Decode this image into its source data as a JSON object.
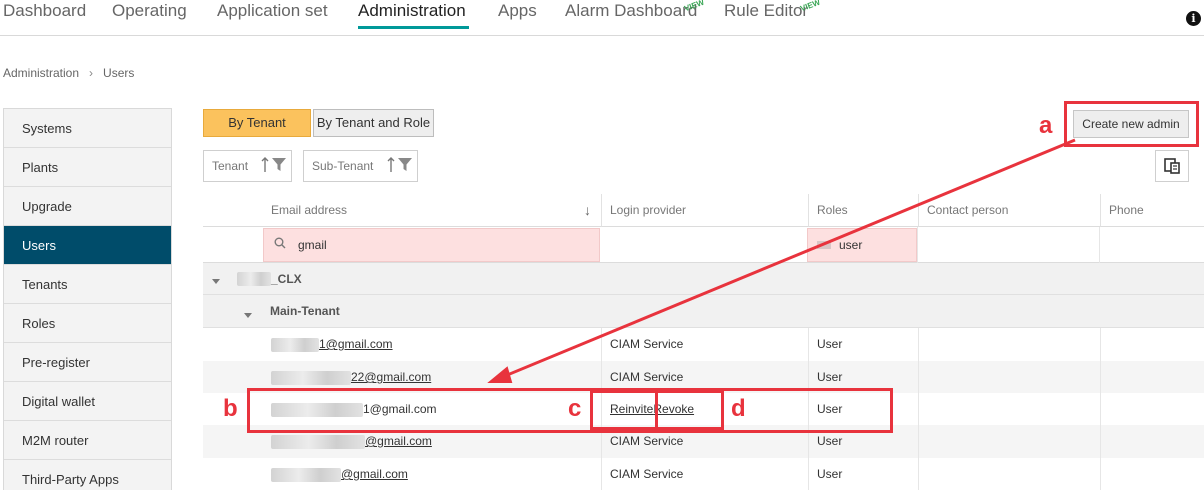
{
  "nav": {
    "tabs": [
      {
        "label": "Dashboard",
        "active": false
      },
      {
        "label": "Operating",
        "active": false
      },
      {
        "label": "Application set",
        "active": false
      },
      {
        "label": "Administration",
        "active": true
      },
      {
        "label": "Apps",
        "active": false
      },
      {
        "label": "Alarm Dashboard",
        "active": false
      },
      {
        "label": "Rule Editor",
        "active": false
      }
    ],
    "preview_badge_1": "VIEW",
    "preview_badge_2": "VIEW",
    "info_icon": "i"
  },
  "breadcrumb": {
    "root": "Administration",
    "current": "Users",
    "separator": "›"
  },
  "sidebar": {
    "items": [
      {
        "label": "Systems"
      },
      {
        "label": "Plants"
      },
      {
        "label": "Upgrade"
      },
      {
        "label": "Users",
        "active": true
      },
      {
        "label": "Tenants"
      },
      {
        "label": "Roles"
      },
      {
        "label": "Pre-register"
      },
      {
        "label": "Digital wallet"
      },
      {
        "label": "M2M router"
      },
      {
        "label": "Third-Party Apps"
      }
    ]
  },
  "toolbar": {
    "by_tenant": "By Tenant",
    "by_tenant_role": "By Tenant and Role",
    "create_admin": "Create new admin",
    "filter_tenant": "Tenant",
    "filter_subtenant": "Sub-Tenant"
  },
  "table": {
    "headers": {
      "email": "Email address",
      "login": "Login provider",
      "roles": "Roles",
      "contact": "Contact person",
      "phone": "Phone"
    },
    "filter_row": {
      "email_value": "gmail",
      "roles_value": "user"
    },
    "group_tenant": "_CLX",
    "group_subtenant": "Main-Tenant",
    "rows": [
      {
        "email": "1@gmail.com",
        "login": "CIAM Service",
        "role": "User"
      },
      {
        "email": "22@gmail.com",
        "login": "CIAM Service",
        "role": "User"
      },
      {
        "email": "1@gmail.com",
        "reinvite": "Reinvite",
        "revoke": "Revoke",
        "role": "User"
      },
      {
        "email": "@gmail.com",
        "login": "CIAM Service",
        "role": "User"
      },
      {
        "email": "@gmail.com",
        "login": "CIAM Service",
        "role": "User"
      }
    ]
  },
  "annotations": {
    "a": "a",
    "b": "b",
    "c": "c",
    "d": "d"
  },
  "colors": {
    "accent": "#009999",
    "active_side": "#004c6a",
    "toggle_on": "#fbc25d",
    "annotation": "#e8333d",
    "filter_bg": "#fde0e0"
  }
}
